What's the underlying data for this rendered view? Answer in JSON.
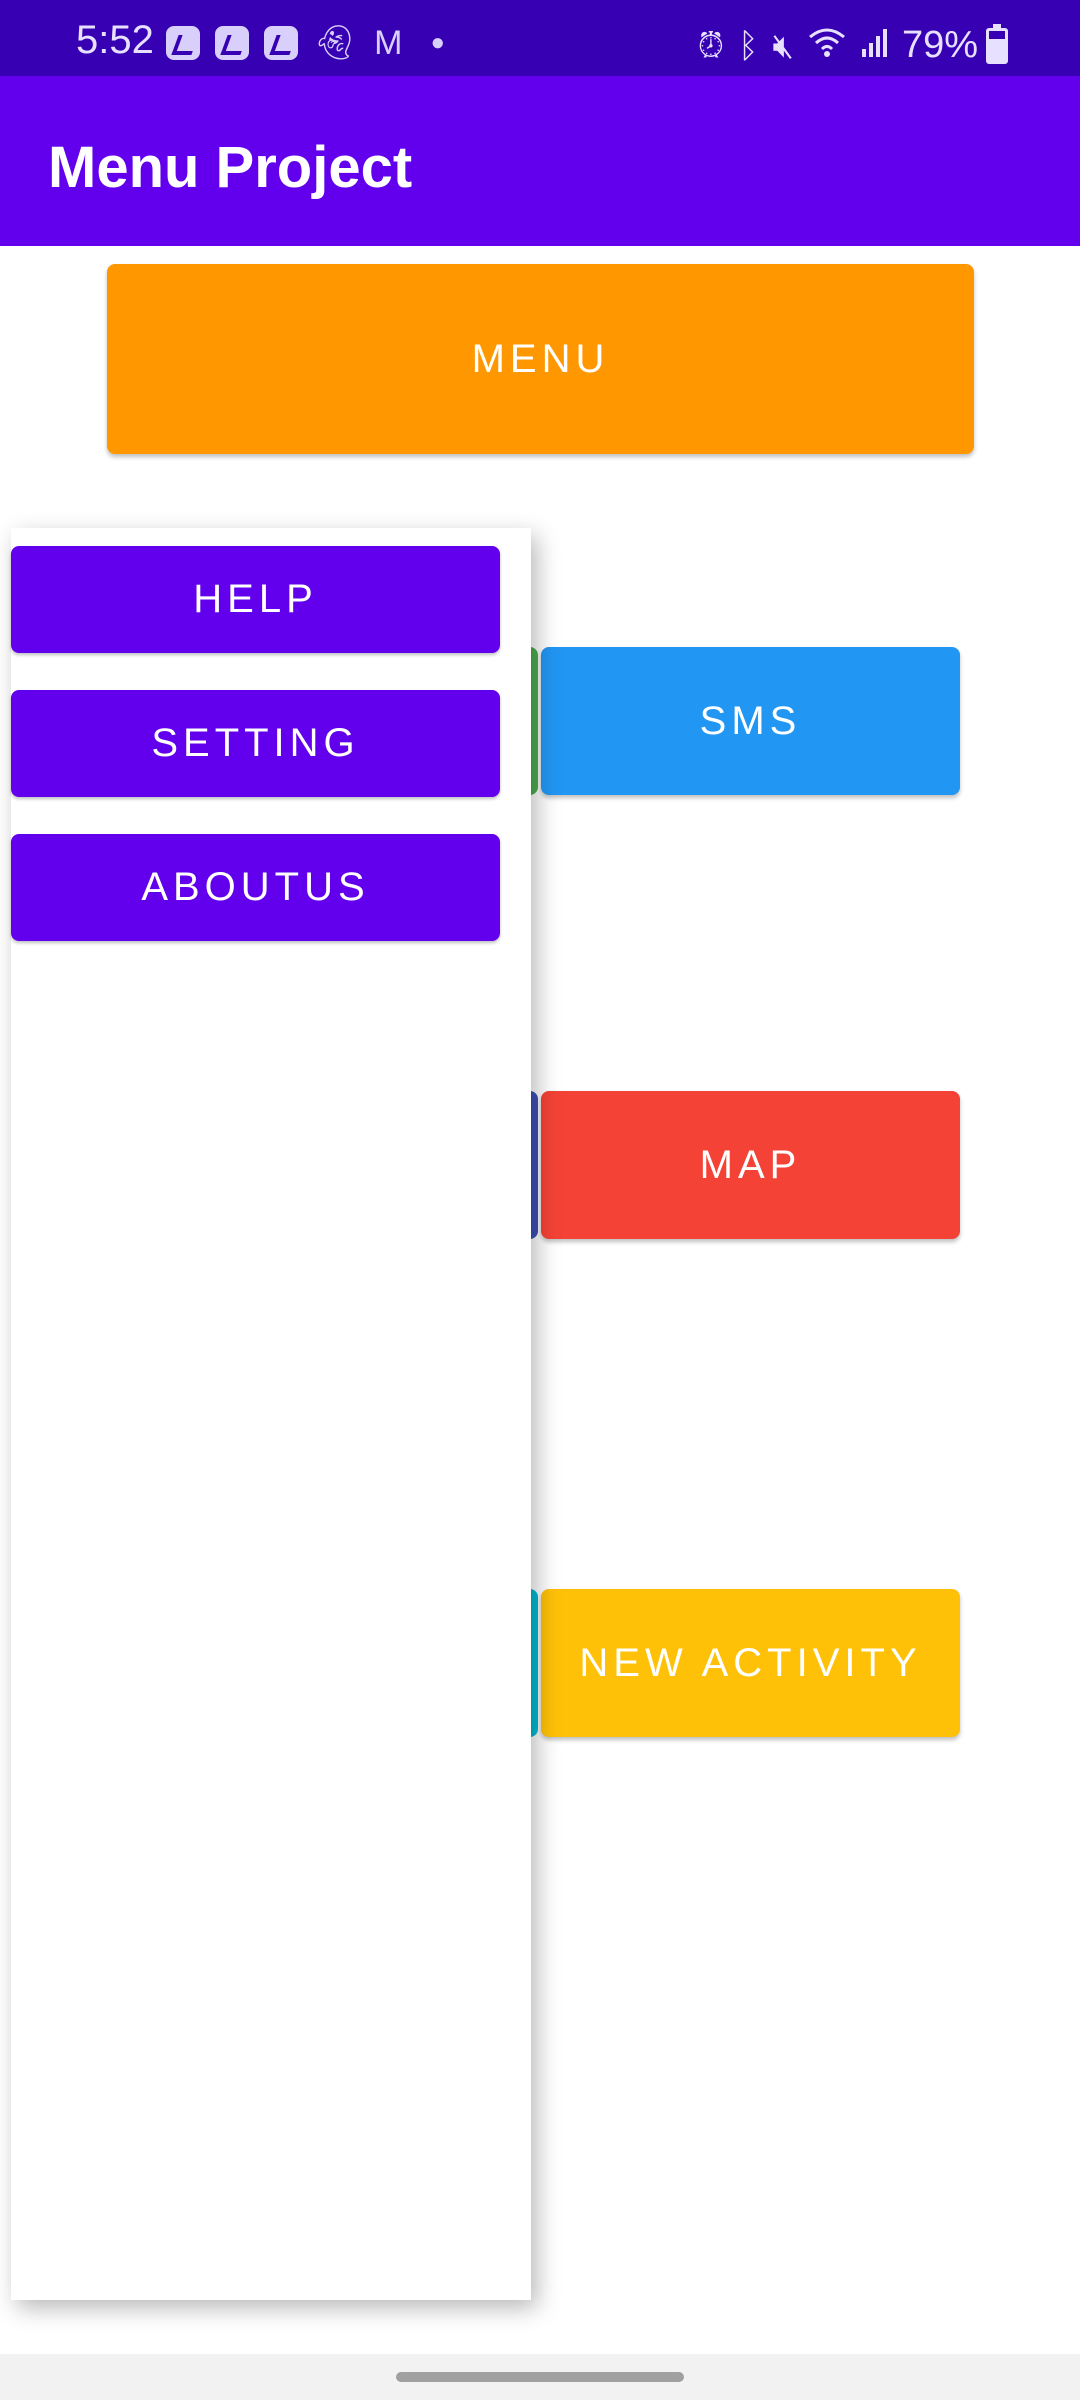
{
  "status_bar": {
    "time": "5:52",
    "battery": "79%",
    "notification_icons": [
      "app-notification-icon",
      "app-notification-icon",
      "app-notification-icon",
      "snapchat-icon",
      "gmail-icon",
      "dot-icon"
    ],
    "system_icons": [
      "alarm-icon",
      "bluetooth-icon",
      "mute-icon",
      "wifi-icon",
      "signal-icon",
      "battery-icon"
    ]
  },
  "app_bar": {
    "title": "Menu Project",
    "color": "#6200ee"
  },
  "main": {
    "menu_button": "MENU",
    "sms_button": "SMS",
    "map_button": "MAP",
    "new_activity_button": "NEW ACTIVITY"
  },
  "popup_menu": {
    "items": [
      {
        "label": "HELP"
      },
      {
        "label": "SETTING"
      },
      {
        "label": "ABOUTUS"
      }
    ]
  },
  "colors": {
    "status_bar": "#3700b3",
    "primary": "#6200ee",
    "menu": "#ff9800",
    "sms": "#2196f3",
    "map": "#f44336",
    "new_activity": "#ffc107",
    "peek_green": "#4caf50",
    "peek_indigo": "#3f51b5",
    "peek_cyan": "#00bcd4"
  }
}
